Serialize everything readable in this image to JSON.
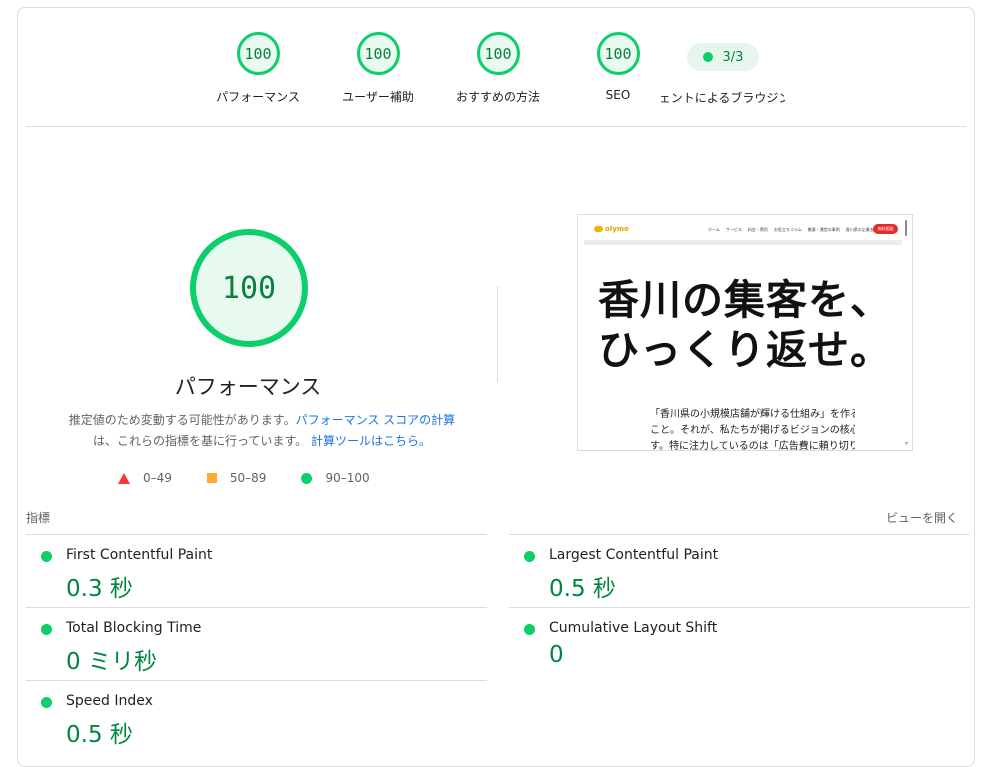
{
  "gauges": [
    {
      "score": "100",
      "label": "パフォーマンス"
    },
    {
      "score": "100",
      "label": "ユーザー補助"
    },
    {
      "score": "100",
      "label": "おすすめの方法"
    },
    {
      "score": "100",
      "label": "SEO"
    }
  ],
  "pwa": {
    "score": "3/3",
    "label": "エージェントによるブラウジング"
  },
  "performance": {
    "score": "100",
    "title": "パフォーマンス",
    "desc_prefix": "推定値のため変動する可能性があります。",
    "desc_link1": "パフォーマンス スコアの計算",
    "desc_mid": "は、これらの指標を基に行っています。",
    "desc_link2": "計算ツールはこちら。"
  },
  "legend": [
    {
      "range": "0–49"
    },
    {
      "range": "50–89"
    },
    {
      "range": "90–100"
    }
  ],
  "screenshot": {
    "logo": "olyme",
    "menu": [
      "ホーム",
      "サービス",
      "料金・費用",
      "お役立ちコラム",
      "集客・運営の事例",
      "香川県の企業支援"
    ],
    "cta": "無料相談",
    "hero_line1": "香川の集客を、",
    "hero_line2": "ひっくり返せ。",
    "body_line1": "「香川県の小規模店舗が輝ける仕組み」を作る",
    "body_line2": "こと。それが、私たちが掲げるビジョンの核心で",
    "body_line3": "す。特に注力しているのは「広告費に頼り切り"
  },
  "metrics_header": "指標",
  "view_toggle": "ビューを開く",
  "metrics": [
    {
      "title": "First Contentful Paint",
      "value": "0.3 秒"
    },
    {
      "title": "Largest Contentful Paint",
      "value": "0.5 秒"
    },
    {
      "title": "Total Blocking Time",
      "value": "0 ミリ秒"
    },
    {
      "title": "Cumulative Layout Shift",
      "value": "0"
    },
    {
      "title": "Speed Index",
      "value": "0.5 秒"
    }
  ],
  "colors": {
    "pass": "#0cce6b",
    "average": "#ffaa33",
    "fail": "#ff3333",
    "link": "#1a73e8"
  }
}
